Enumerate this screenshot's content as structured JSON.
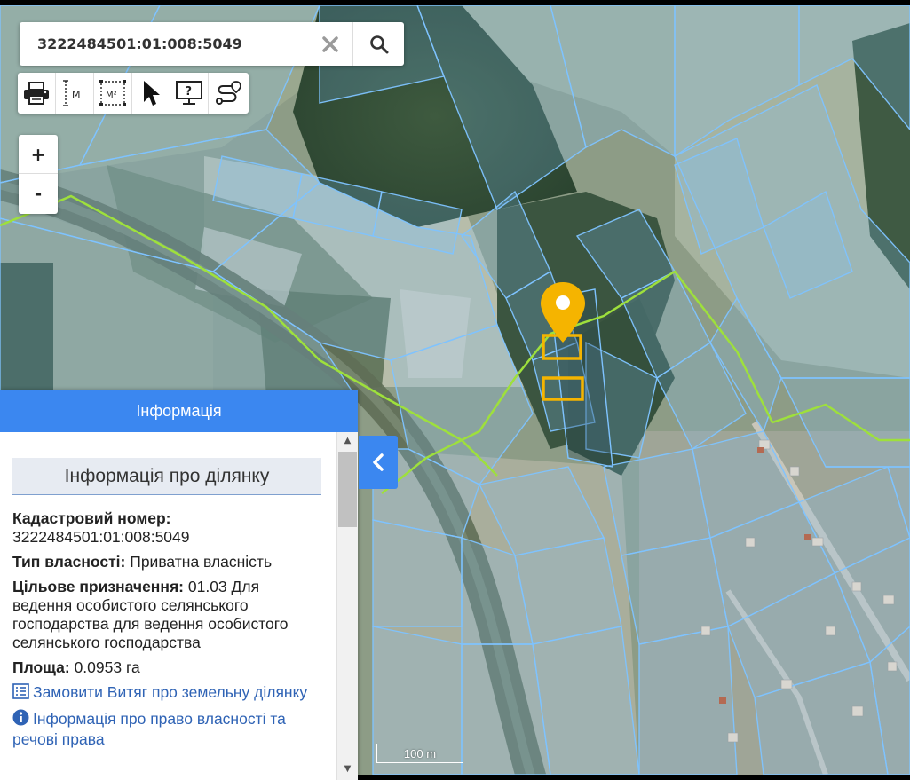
{
  "search": {
    "value": "3222484501:01:008:5049",
    "clear_icon": "close-icon",
    "search_icon": "search-icon"
  },
  "toolbar": {
    "tools": [
      "print-icon",
      "measure-distance-icon",
      "measure-area-icon",
      "pointer-icon",
      "help-icon",
      "route-icon"
    ],
    "measure_distance_label": "M",
    "measure_area_label": "M²"
  },
  "zoom": {
    "in_label": "+",
    "out_label": "-"
  },
  "panel": {
    "header": "Інформація",
    "section_title": "Інформація про ділянку",
    "cadastral_label": "Кадастровий номер:",
    "cadastral_value": "3222484501:01:008:5049",
    "ownership_label": "Тип власності:",
    "ownership_value": "Приватна власність",
    "purpose_label": "Цільове призначення:",
    "purpose_value": "01.03 Для ведення особистого селянського господарства для ведення особистого селянського господарства",
    "area_label": "Площа:",
    "area_value": "0.0953 га",
    "link_extract": "Замовити Витяг про земельну ділянку",
    "link_rights": "Інформація про право власності та речові права"
  },
  "scale": {
    "label": "100 m"
  },
  "colors": {
    "accent": "#3b87f0",
    "parcel_stroke": "#7ec3ff",
    "boundary_line": "#9ee03c",
    "marker": "#f5b400"
  }
}
